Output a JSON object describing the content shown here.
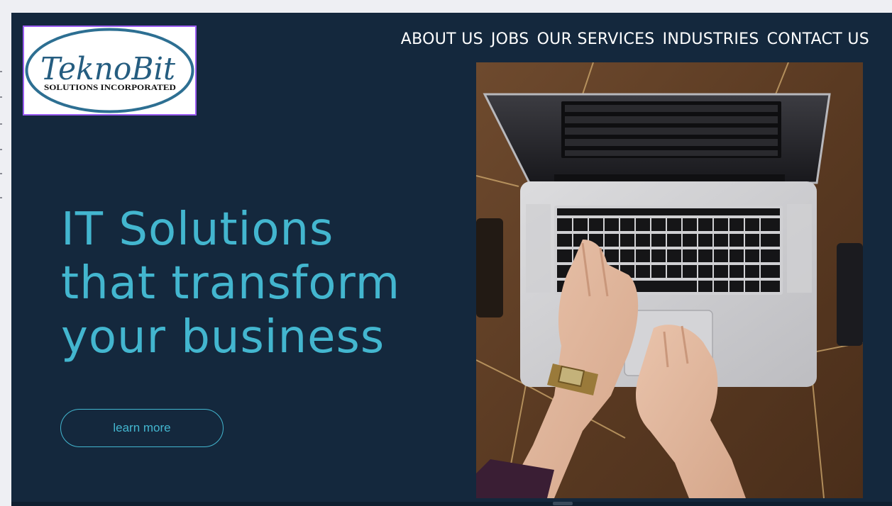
{
  "logo": {
    "name": "TeknoBit",
    "tagline": "SOLUTIONS INCORPORATED"
  },
  "nav": {
    "items": [
      "ABOUT US",
      "JOBS",
      "OUR SERVICES",
      "INDUSTRIES",
      "CONTACT US"
    ]
  },
  "hero": {
    "lines": [
      "IT Solutions",
      "that transform",
      "your business"
    ],
    "cta_label": "learn more"
  },
  "colors": {
    "background": "#14283d",
    "accent": "#43b6cf",
    "nav_text": "#ffffff",
    "logo_border": "#9a5cf0"
  },
  "image": {
    "subject": "laptop-typing-photo"
  }
}
